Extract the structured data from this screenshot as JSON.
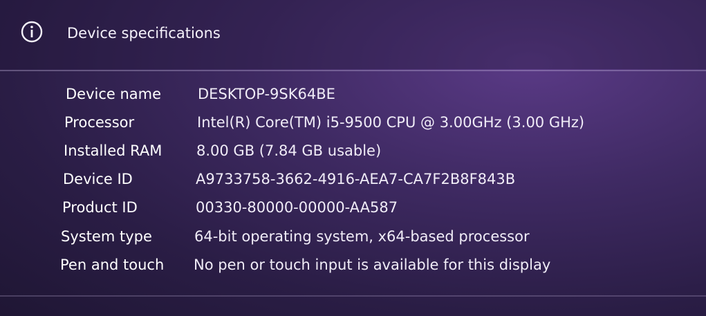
{
  "section": {
    "title": "Device specifications",
    "icon": "info-icon"
  },
  "specs": [
    {
      "label": "Device name",
      "value": "DESKTOP-9SK64BE"
    },
    {
      "label": "Processor",
      "value": "Intel(R) Core(TM) i5-9500 CPU @ 3.00GHz (3.00 GHz)"
    },
    {
      "label": "Installed RAM",
      "value": "8.00 GB (7.84 GB usable)"
    },
    {
      "label": "Device ID",
      "value": "A9733758-3662-4916-AEA7-CA7F2B8F843B"
    },
    {
      "label": "Product ID",
      "value": "00330-80000-00000-AA587"
    },
    {
      "label": "System type",
      "value": "64-bit operating system, x64-based processor"
    },
    {
      "label": "Pen and touch",
      "value": "No pen or touch input is available for this display"
    }
  ]
}
